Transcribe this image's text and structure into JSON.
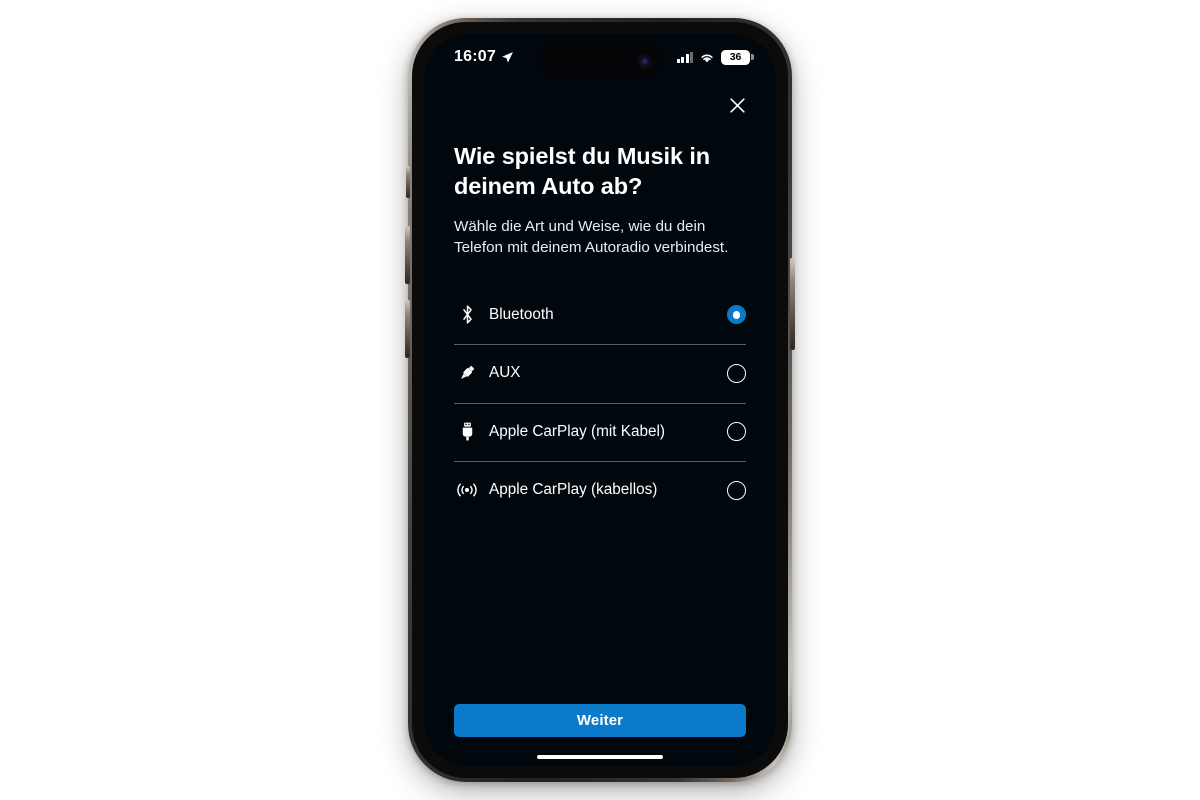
{
  "status_bar": {
    "time": "16:07",
    "location_icon": "location-arrow-icon",
    "cellular_icon": "cellular-signal-icon",
    "wifi_icon": "wifi-icon",
    "battery_level": "36",
    "battery_icon": "battery-icon"
  },
  "screen": {
    "close_icon": "close-icon",
    "title": "Wie spielst du Musik in deinem Auto ab?",
    "subtitle": "Wähle die Art und Weise, wie du dein Telefon mit deinem Autoradio verbindest.",
    "options": [
      {
        "id": "bluetooth",
        "label": "Bluetooth",
        "icon": "bluetooth-icon",
        "selected": true
      },
      {
        "id": "aux",
        "label": "AUX",
        "icon": "aux-plug-icon",
        "selected": false
      },
      {
        "id": "carplay-wired",
        "label": "Apple CarPlay (mit Kabel)",
        "icon": "usb-connector-icon",
        "selected": false
      },
      {
        "id": "carplay-wireless",
        "label": "Apple CarPlay (kabellos)",
        "icon": "wireless-broadcast-icon",
        "selected": false
      }
    ],
    "primary_button": "Weiter"
  },
  "colors": {
    "accent": "#0b7ac9",
    "screen_background": "#00070d",
    "text_primary": "#ffffff",
    "divider": "#555e66",
    "page_background": "#ffffff"
  }
}
